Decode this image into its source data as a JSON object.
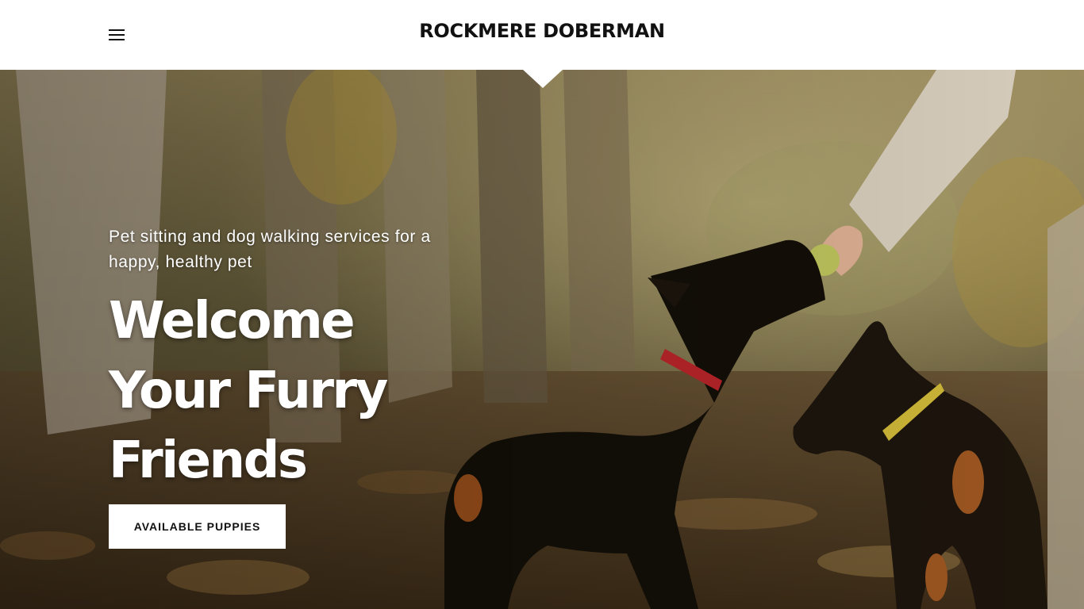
{
  "header": {
    "brand": "ROCKMERE DOBERMAN",
    "menu_icon": "hamburger-menu-icon"
  },
  "hero": {
    "image": "two-doberman-dogs-playing-with-ball-in-autumn-park",
    "tagline": "Pet sitting and dog walking services for a happy, healthy pet",
    "headline": "Welcome Your Furry Friends",
    "cta_label": "AVAILABLE PUPPIES"
  },
  "colors": {
    "header_bg": "#ffffff",
    "brand_text": "#111111",
    "hero_text": "#ffffff",
    "button_bg": "#ffffff",
    "button_text": "#111111"
  }
}
